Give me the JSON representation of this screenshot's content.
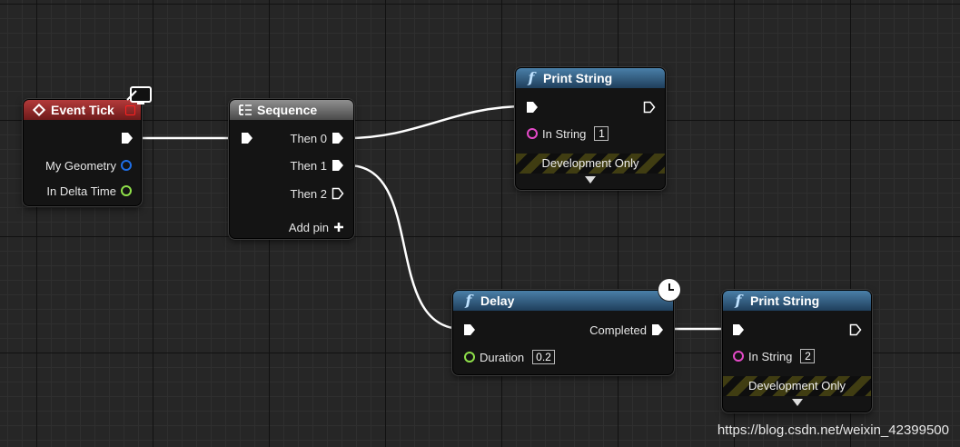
{
  "nodes": {
    "event_tick": {
      "title": "Event Tick",
      "pins": {
        "my_geometry": "My Geometry",
        "in_delta_time": "In Delta Time"
      }
    },
    "sequence": {
      "title": "Sequence",
      "pins": {
        "then0": "Then 0",
        "then1": "Then 1",
        "then2": "Then 2",
        "add_pin": "Add pin"
      }
    },
    "print_string_1": {
      "title": "Print String",
      "in_string_label": "In String",
      "in_string_value": "1",
      "dev_only": "Development Only"
    },
    "delay": {
      "title": "Delay",
      "completed_label": "Completed",
      "duration_label": "Duration",
      "duration_value": "0.2"
    },
    "print_string_2": {
      "title": "Print String",
      "in_string_label": "In String",
      "in_string_value": "2",
      "dev_only": "Development Only"
    }
  },
  "watermark": "https://blog.csdn.net/weixin_42399500",
  "icons": {
    "event": "event-diamond-icon",
    "sequence": "sequence-icon",
    "function": "function-f-icon",
    "latent": "clock-icon",
    "monitor": "monitor-icon",
    "add": "plus-icon"
  },
  "colors": {
    "event_header": "#b33a3a",
    "function_header": "#4a7fa8",
    "sequence_header": "#909090",
    "wire": "#ffffff",
    "pin_struct": "#1e6ee6",
    "pin_float": "#8fe04a",
    "pin_string": "#e44ac8"
  }
}
